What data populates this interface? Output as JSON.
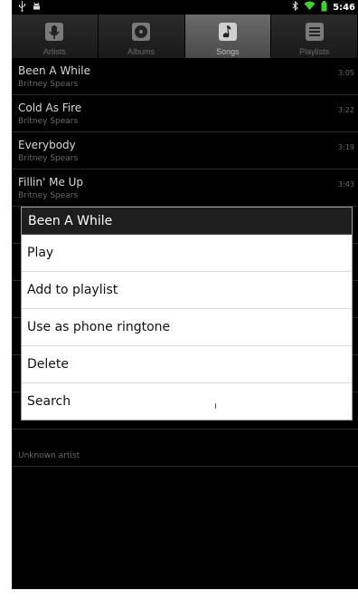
{
  "status_bar": {
    "icons": [
      "usb-icon",
      "android-debug-icon",
      "bluetooth-icon",
      "wifi-icon",
      "battery-icon"
    ],
    "time": "5:46"
  },
  "tabs": [
    {
      "label": "Artists",
      "icon": "artist-icon",
      "active": false
    },
    {
      "label": "Albums",
      "icon": "album-icon",
      "active": false
    },
    {
      "label": "Songs",
      "icon": "song-icon",
      "active": true
    },
    {
      "label": "Playlists",
      "icon": "playlist-icon",
      "active": false
    }
  ],
  "songs": [
    {
      "title": "Been A While",
      "artist": "Britney Spears",
      "duration": "3:05"
    },
    {
      "title": "Cold As Fire",
      "artist": "Britney Spears",
      "duration": "3:22"
    },
    {
      "title": "Everybody",
      "artist": "Britney Spears",
      "duration": "3:19"
    },
    {
      "title": "Fillin' Me Up",
      "artist": "Britney Spears",
      "duration": "3:43"
    },
    {
      "title": "",
      "artist": "",
      "duration": ""
    },
    {
      "title": "",
      "artist": "",
      "duration": ""
    },
    {
      "title": "",
      "artist": "",
      "duration": ""
    },
    {
      "title": "",
      "artist": "",
      "duration": ""
    },
    {
      "title": "",
      "artist": "",
      "duration": ""
    },
    {
      "title": "",
      "artist": "",
      "duration": ""
    },
    {
      "title": "",
      "artist": "Unknown artist",
      "duration": ""
    }
  ],
  "context_menu": {
    "title": "Been A While",
    "items": [
      "Play",
      "Add to playlist",
      "Use as phone ringtone",
      "Delete",
      "Search"
    ]
  },
  "colors": {
    "active_tab": "#5a5a5a",
    "text_primary": "#d9d9d9",
    "text_secondary": "#6a6a6a",
    "wifi_green": "#3fcf2f",
    "battery_green": "#3fcf2f"
  }
}
